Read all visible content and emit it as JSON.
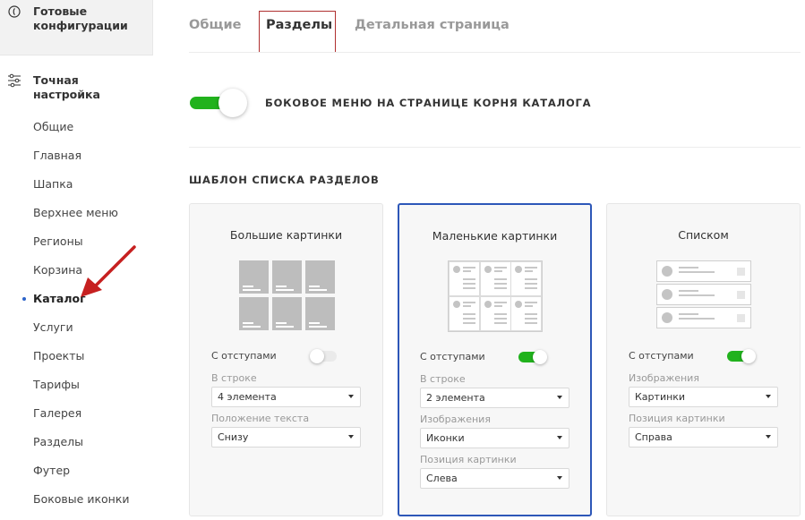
{
  "sidebar": {
    "top_title": "Готовые конфигурации",
    "section_title": "Точная настройка",
    "items": [
      {
        "label": "Общие"
      },
      {
        "label": "Главная"
      },
      {
        "label": "Шапка"
      },
      {
        "label": "Верхнее меню"
      },
      {
        "label": "Регионы"
      },
      {
        "label": "Корзина"
      },
      {
        "label": "Каталог",
        "active": true
      },
      {
        "label": "Услуги"
      },
      {
        "label": "Проекты"
      },
      {
        "label": "Тарифы"
      },
      {
        "label": "Галерея"
      },
      {
        "label": "Разделы"
      },
      {
        "label": "Футер"
      },
      {
        "label": "Боковые иконки"
      }
    ]
  },
  "tabs": [
    {
      "label": "Общие"
    },
    {
      "label": "Разделы",
      "active": true
    },
    {
      "label": "Детальная страница"
    }
  ],
  "side_menu_toggle": {
    "label": "БОКОВОЕ МЕНЮ НА СТРАНИЦЕ КОРНЯ КАТАЛОГА",
    "on": true
  },
  "section_title": "ШАБЛОН СПИСКА РАЗДЕЛОВ",
  "cards": [
    {
      "title": "Большие картинки",
      "selected": false,
      "indent_label": "С отступами",
      "indent_on": false,
      "field1_label": "В строке",
      "field1_value": "4 элемента",
      "field2_label": "Положение текста",
      "field2_value": "Снизу"
    },
    {
      "title": "Маленькие картинки",
      "selected": true,
      "indent_label": "С отступами",
      "indent_on": true,
      "field1_label": "В строке",
      "field1_value": "2 элемента",
      "field2_label": "Изображения",
      "field2_value": "Иконки",
      "field3_label": "Позиция картинки",
      "field3_value": "Слева"
    },
    {
      "title": "Списком",
      "selected": false,
      "indent_label": "С отступами",
      "indent_on": true,
      "field1_label": "Изображения",
      "field1_value": "Картинки",
      "field2_label": "Позиция картинки",
      "field2_value": "Справа"
    }
  ],
  "colors": {
    "accent_green": "#21b21d",
    "selected_border": "#2d57b8",
    "active_tab_border": "#b03030",
    "annotation_arrow": "#c62020",
    "active_dot": "#2c63c9"
  }
}
